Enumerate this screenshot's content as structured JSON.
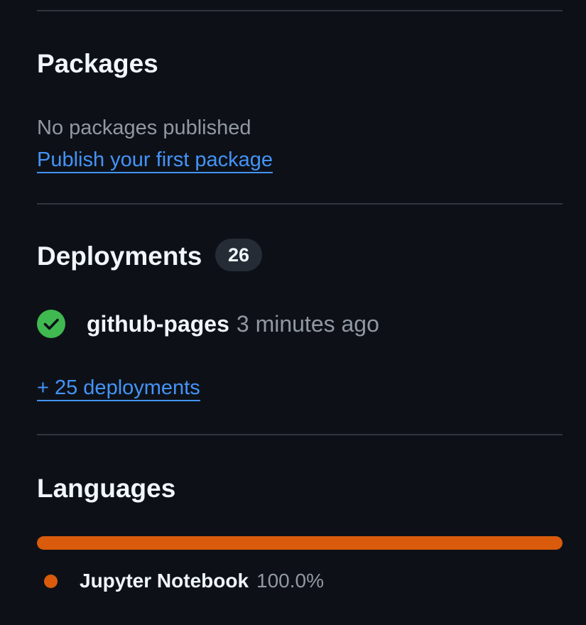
{
  "packages": {
    "title": "Packages",
    "empty_text": "No packages published",
    "publish_link": "Publish your first package"
  },
  "deployments": {
    "title": "Deployments",
    "count": "26",
    "items": [
      {
        "name": "github-pages",
        "time": "3 minutes ago",
        "status": "success",
        "status_icon": "check-circle-icon",
        "status_color": "#3fb950"
      }
    ],
    "more_link": "+ 25 deployments"
  },
  "languages": {
    "title": "Languages",
    "items": [
      {
        "name": "Jupyter Notebook",
        "percent_label": "100.0%",
        "percent": 100.0,
        "color": "#da5b0b"
      }
    ]
  },
  "colors": {
    "background": "#0d1117",
    "link": "#4493f8",
    "divider": "#30363d"
  }
}
